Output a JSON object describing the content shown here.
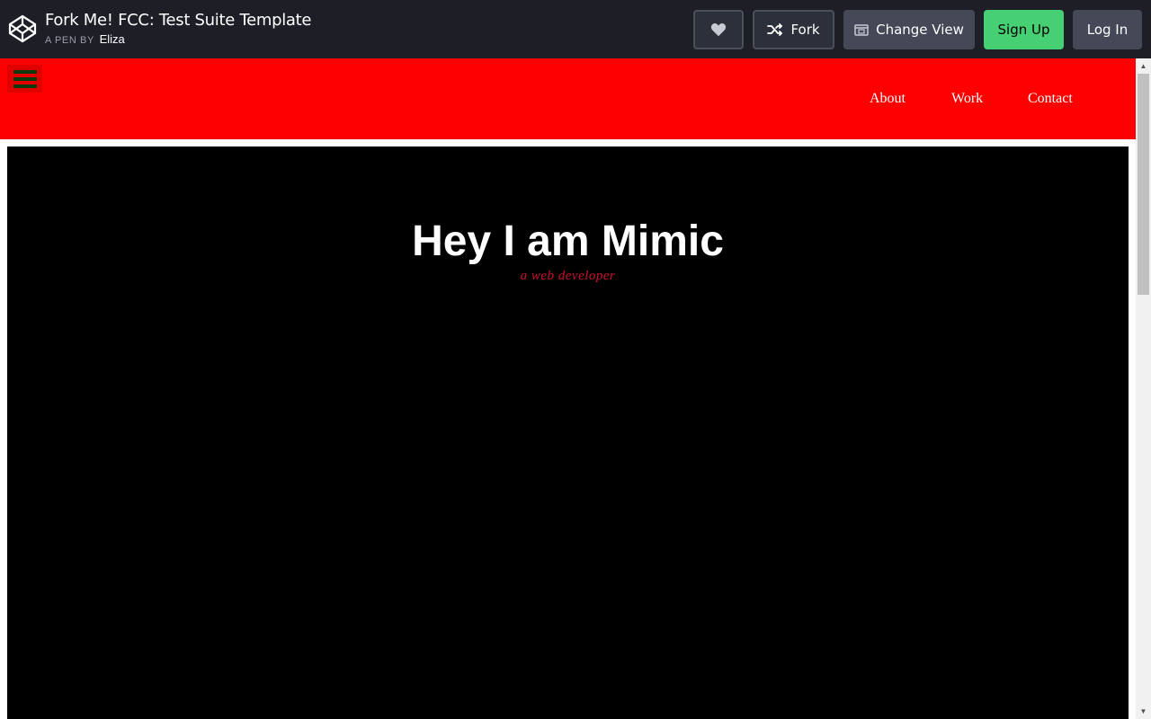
{
  "codepen": {
    "title": "Fork Me! FCC: Test Suite Template",
    "pen_by_label": "A PEN BY",
    "author": "Eliza",
    "logo_icon": "codepen-logo-icon",
    "buttons": {
      "heart_icon": "heart-icon",
      "fork_label": "Fork",
      "fork_icon": "fork-icon",
      "change_view_label": "Change View",
      "change_view_icon": "window-icon",
      "signup_label": "Sign Up",
      "login_label": "Log In"
    },
    "colors": {
      "header_bg": "#1e1f26",
      "signup_green": "#47cf73",
      "button_gray": "#444857"
    }
  },
  "site": {
    "nav": {
      "menu_icon": "hamburger-menu-icon",
      "links": [
        "About",
        "Work",
        "Contact"
      ],
      "bg_color": "#ff0000"
    },
    "hero": {
      "title": "Hey I am Mimic",
      "subtitle": "a web developer",
      "bg_color": "#000000",
      "subtitle_color": "#c8102e"
    }
  }
}
